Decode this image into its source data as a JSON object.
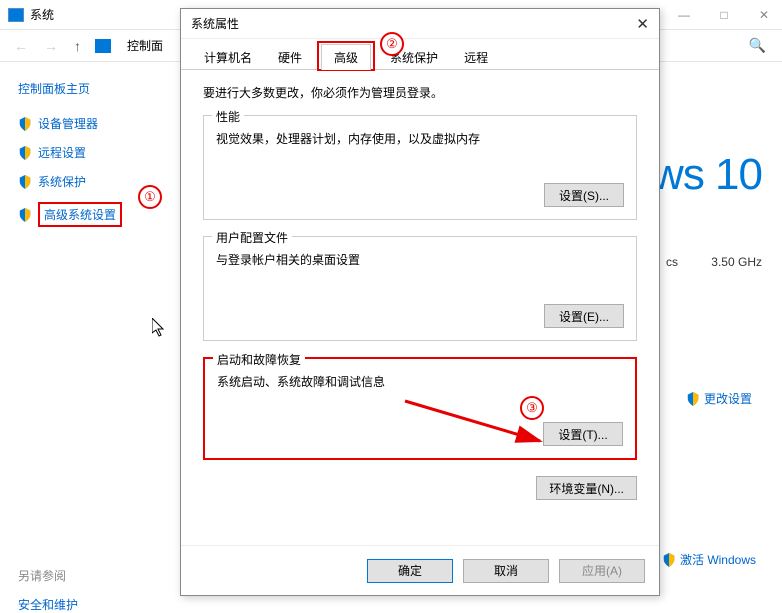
{
  "explorer": {
    "title": "系统",
    "breadcrumb": "控制面",
    "sidebar_title": "控制面板主页",
    "links": {
      "device_mgr": "设备管理器",
      "remote": "远程设置",
      "sys_protect": "系统保护",
      "adv_sys": "高级系统设置"
    },
    "see_also": "另请参阅",
    "security": "安全和维护",
    "win_brand": "ws 10",
    "spec_col1": "cs",
    "spec_col2": "3.50 GHz",
    "change_link": "更改设置",
    "activate_link": "激活 Windows"
  },
  "dialog": {
    "title": "系统属性",
    "tabs": {
      "computer": "计算机名",
      "hardware": "硬件",
      "advanced": "高级",
      "protect": "系统保护",
      "remote": "远程"
    },
    "admin_note": "要进行大多数更改，你必须作为管理员登录。",
    "perf": {
      "title": "性能",
      "desc": "视觉效果，处理器计划，内存使用，以及虚拟内存",
      "btn": "设置(S)..."
    },
    "profile": {
      "title": "用户配置文件",
      "desc": "与登录帐户相关的桌面设置",
      "btn": "设置(E)..."
    },
    "startup": {
      "title": "启动和故障恢复",
      "desc": "系统启动、系统故障和调试信息",
      "btn": "设置(T)..."
    },
    "env_btn": "环境变量(N)...",
    "ok": "确定",
    "cancel": "取消",
    "apply": "应用(A)"
  },
  "anno": {
    "n1": "①",
    "n2": "②",
    "n3": "③"
  }
}
